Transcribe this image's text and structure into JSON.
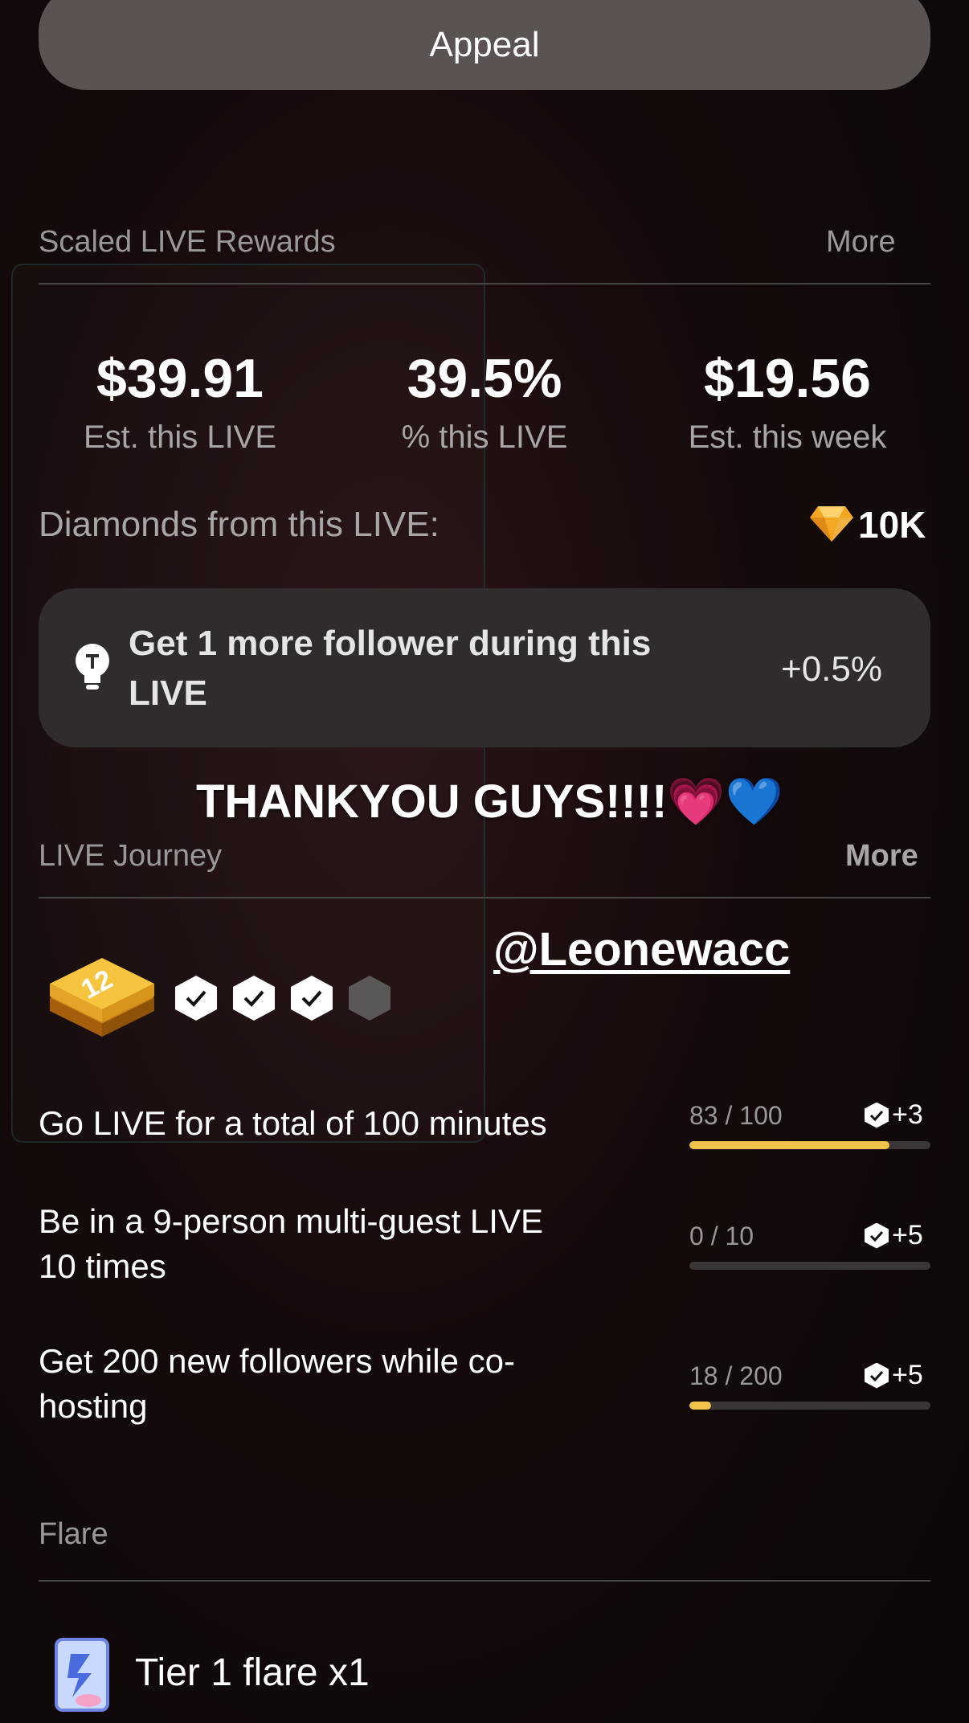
{
  "appeal": {
    "label": "Appeal"
  },
  "scaled_rewards": {
    "title": "Scaled LIVE Rewards",
    "more": "More",
    "stats": [
      {
        "value": "$39.91",
        "label": "Est. this LIVE"
      },
      {
        "value": "39.5%",
        "label": "% this LIVE"
      },
      {
        "value": "$19.56",
        "label": "Est. this week"
      }
    ],
    "diamonds_label": "Diamonds from this LIVE:",
    "diamonds_value": "10K",
    "tip_line1": "Get 1 more follower during this",
    "tip_line2": "LIVE",
    "tip_bonus": "+0.5%"
  },
  "sticker_text": "THANKYOU GUYS!!!!💗💙",
  "handle": "@Leonewacc",
  "journey": {
    "title": "LIVE Journey",
    "more": "More",
    "level": "12",
    "checks": [
      true,
      true,
      true,
      false
    ],
    "tasks": [
      {
        "line1": "Go LIVE for a total of 100 minutes",
        "line2": "",
        "progress": "83 / 100",
        "fraction": 0.83,
        "reward": "+3"
      },
      {
        "line1": "Be in a 9-person multi-guest LIVE",
        "line2": "10 times",
        "progress": "0 / 10",
        "fraction": 0.0,
        "reward": "+5"
      },
      {
        "line1": "Get 200 new followers while co-",
        "line2": "hosting",
        "progress": "18 / 200",
        "fraction": 0.09,
        "reward": "+5"
      }
    ]
  },
  "flare": {
    "title": "Flare",
    "item_label": "Tier 1 flare x1"
  },
  "colors": {
    "accent_gold": "#f2c34a",
    "card_bg": "#312c2c",
    "muted_text": "#9a9797"
  }
}
